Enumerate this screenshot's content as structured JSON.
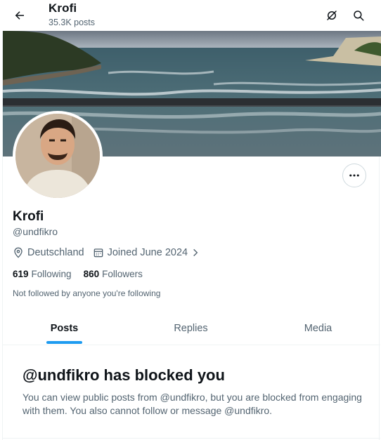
{
  "header": {
    "title": "Krofi",
    "post_count": "35.3K posts"
  },
  "profile": {
    "name": "Krofi",
    "handle": "@undfikro",
    "location": "Deutschland",
    "joined": "Joined June 2024",
    "following_count": "619",
    "following_label": "Following",
    "followers_count": "860",
    "followers_label": "Followers",
    "not_followed_note": "Not followed by anyone you're following"
  },
  "tabs": [
    {
      "label": "Posts",
      "active": true
    },
    {
      "label": "Replies",
      "active": false
    },
    {
      "label": "Media",
      "active": false
    }
  ],
  "blocked": {
    "title": "@undfikro has blocked you",
    "message": "You can view public posts from @undfikro, but you are blocked from engaging with them. You also cannot follow or message @undfikro."
  },
  "colors": {
    "accent": "#1d9bf0",
    "text_primary": "#0f1419",
    "text_secondary": "#536471"
  },
  "icons": {
    "back": "arrow-left-icon",
    "grok": "grok-icon",
    "search": "search-icon",
    "more": "more-dots-icon",
    "location": "location-pin-icon",
    "calendar": "calendar-icon",
    "chevron": "chevron-right-icon"
  }
}
